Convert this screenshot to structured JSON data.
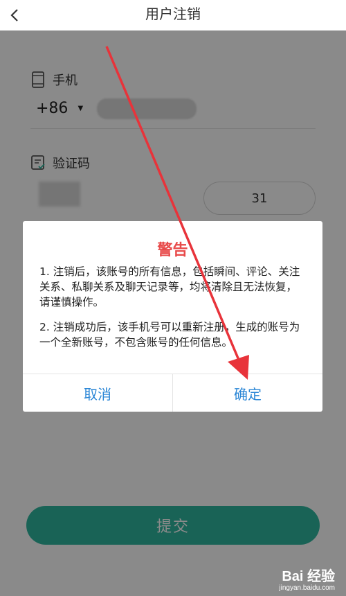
{
  "header": {
    "title": "用户注销"
  },
  "form": {
    "phone_label": "手机",
    "country_code": "+86",
    "verification_label": "验证码",
    "countdown_value": "31",
    "submit_label": "提交"
  },
  "dialog": {
    "title": "警告",
    "paragraph1": "1. 注销后，该账号的所有信息，包括瞬间、评论、关注关系、私聊关系及聊天记录等，均将清除且无法恢复，请谨慎操作。",
    "paragraph2": "2. 注销成功后，该手机号可以重新注册，生成的账号为一个全新账号，不包含账号的任何信息。",
    "cancel_label": "取消",
    "confirm_label": "确定"
  },
  "watermark": {
    "logo_text": "Bai 经验",
    "url": "jingyan.baidu.com"
  },
  "colors": {
    "accent_green": "#2fb89f",
    "warning_red": "#e84a4a",
    "dialog_button_blue": "#2a86d6",
    "arrow_red": "#e8333a"
  }
}
